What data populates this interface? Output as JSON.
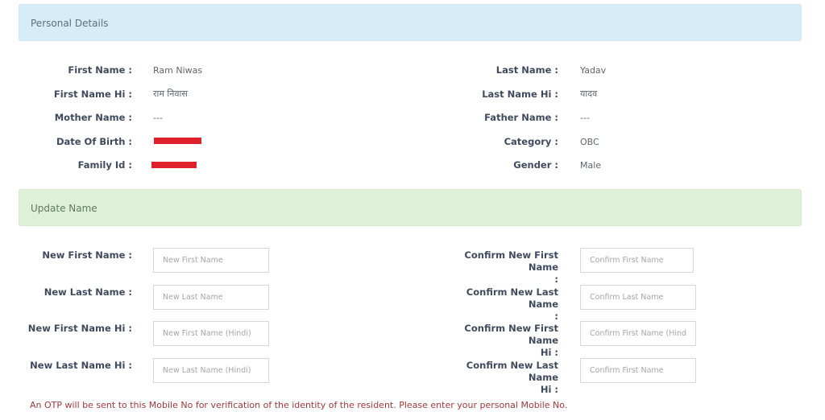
{
  "personal_details": {
    "title": "Personal Details",
    "left": [
      {
        "label": "First Name :",
        "value": "Ram Niwas"
      },
      {
        "label": "First Name Hi :",
        "value": "राम निवास"
      },
      {
        "label": "Mother Name :",
        "value": "---"
      },
      {
        "label": "Date Of Birth :",
        "value": "[redacted]"
      },
      {
        "label": "Family Id :",
        "value": "[redacted]"
      }
    ],
    "right": [
      {
        "label": "Last Name :",
        "value": "Yadav"
      },
      {
        "label": "Last Name Hi :",
        "value": "यादव"
      },
      {
        "label": "Father Name :",
        "value": "---"
      },
      {
        "label": "Category :",
        "value": "OBC"
      },
      {
        "label": "Gender :",
        "value": "Male"
      }
    ],
    "redaction_color": "#e0202b"
  },
  "update_name": {
    "title": "Update Name",
    "left": [
      {
        "label": "New First Name :",
        "placeholder": "New First Name",
        "value": ""
      },
      {
        "label": "New Last Name :",
        "placeholder": "New Last Name",
        "value": ""
      },
      {
        "label": "New First Name Hi :",
        "placeholder": "New First Name (Hindi)",
        "value": ""
      },
      {
        "label": "New Last Name Hi :",
        "placeholder": "New Last Name (Hindi)",
        "value": ""
      }
    ],
    "right": [
      {
        "label_line1": "Confirm New First Name",
        "label_line2": ":",
        "placeholder": "Confirm First Name",
        "value": ""
      },
      {
        "label_line1": "Confirm New Last Name",
        "label_line2": ":",
        "placeholder": "Confirm Last Name",
        "value": ""
      },
      {
        "label_line1": "Confirm New First Name",
        "label_line2": "Hi :",
        "placeholder": "Confirm First Name (Hindi)",
        "value": ""
      },
      {
        "label_line1": "Confirm New Last Name",
        "label_line2": "Hi :",
        "placeholder": "Confirm First Name",
        "value": ""
      }
    ]
  },
  "otp_note": "An OTP will be sent to this Mobile No for verification of the identity of the resident. Please enter your personal Mobile No.",
  "colors": {
    "info_header_bg": "#d6ecf6",
    "success_header_bg": "#dff0d8",
    "warning_text": "#a03a3a"
  }
}
